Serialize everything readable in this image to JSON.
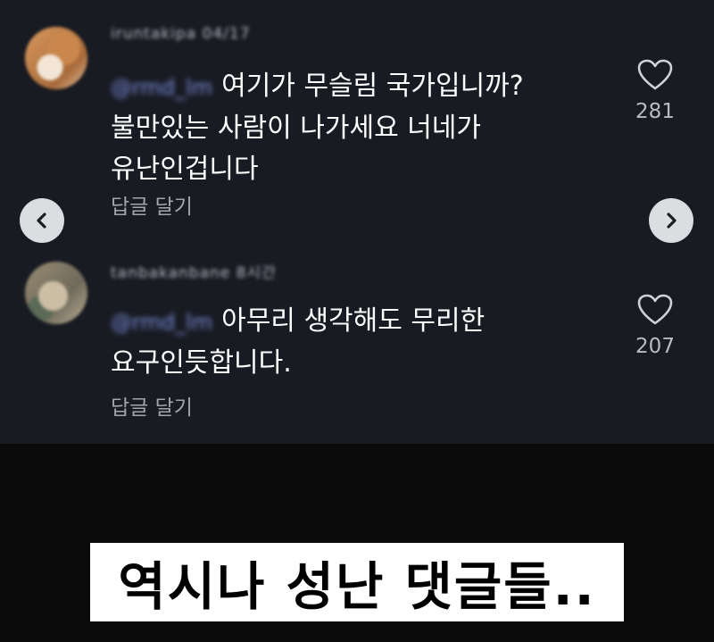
{
  "comments": [
    {
      "username": "iruntakipa 04/17",
      "mention": "@rmd_lm",
      "lines": [
        "여기가 무슬림 국가입니까?",
        "불만있는 사람이 나가세요 너네가",
        "유난인겁니다"
      ],
      "reply_label": "답글 달기",
      "likes": "281"
    },
    {
      "username": "tanbakanbane 8시간",
      "mention": "@rmd_lm",
      "lines": [
        "아무리 생각해도 무리한",
        "요구인듯합니다."
      ],
      "reply_label": "답글 달기",
      "likes": "207"
    }
  ],
  "nav": {
    "prev_glyph": "‹",
    "next_glyph": "›"
  },
  "caption": "역시나 성난 댓글들..",
  "colors": {
    "panel_bg": "#181b22",
    "bottom_bg": "#0b0b0c",
    "mention": "#7e8fe0",
    "secondary_text": "#a3a5ad",
    "caption_bg": "#ffffff",
    "caption_text": "#000000"
  },
  "icons": [
    "heart-icon",
    "chevron-left-icon",
    "chevron-right-icon"
  ]
}
